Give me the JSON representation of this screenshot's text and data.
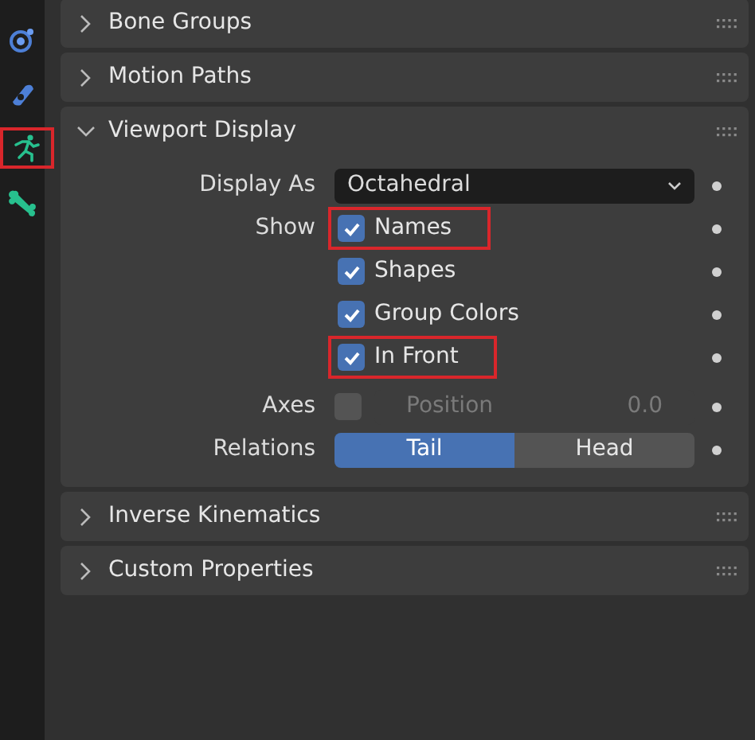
{
  "sidebar_tabs": [
    {
      "highlighted": false
    },
    {
      "highlighted": false
    },
    {
      "highlighted": true
    },
    {
      "highlighted": false
    }
  ],
  "panels": [
    {
      "title": "Bone Groups",
      "expanded": false
    },
    {
      "title": "Motion Paths",
      "expanded": false
    },
    {
      "title": "Viewport Display",
      "expanded": true,
      "content": {
        "display_as": {
          "label": "Display As",
          "value": "Octahedral"
        },
        "show": {
          "label": "Show",
          "options": [
            {
              "label": "Names",
              "checked": true,
              "highlighted": true
            },
            {
              "label": "Shapes",
              "checked": true,
              "highlighted": false
            },
            {
              "label": "Group Colors",
              "checked": true,
              "highlighted": false
            },
            {
              "label": "In Front",
              "checked": true,
              "highlighted": true
            }
          ]
        },
        "axes": {
          "label": "Axes",
          "checked": false,
          "field_label": "Position",
          "value": "0.0"
        },
        "relations": {
          "label": "Relations",
          "options": [
            {
              "label": "Tail",
              "selected": true
            },
            {
              "label": "Head",
              "selected": false
            }
          ]
        }
      }
    },
    {
      "title": "Inverse Kinematics",
      "expanded": false
    },
    {
      "title": "Custom Properties",
      "expanded": false
    }
  ]
}
